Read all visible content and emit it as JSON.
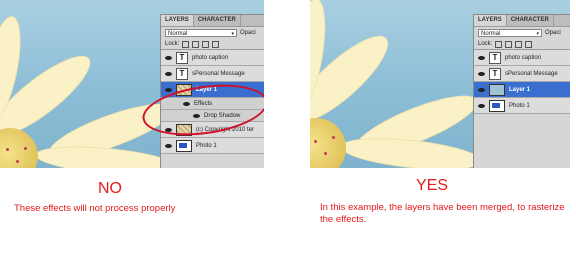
{
  "left": {
    "tabs": [
      "LAYERS",
      "CHARACTER"
    ],
    "blend_mode": "Normal",
    "opacity_label": "Opaci",
    "lock_label": "Lock:",
    "layers": [
      {
        "type": "text",
        "name": "photo caption"
      },
      {
        "type": "text",
        "name": "sPersonal Message"
      },
      {
        "type": "image",
        "name": "Layer 1",
        "selected": true
      },
      {
        "type": "effects",
        "name": "Effects"
      },
      {
        "type": "effect",
        "name": "Drop Shadow"
      },
      {
        "type": "image",
        "name": "(c) Copyright 2010 ter"
      },
      {
        "type": "photo",
        "name": "Photo 1"
      }
    ],
    "verdict": "NO",
    "description": "These effects will not process properly"
  },
  "right": {
    "tabs": [
      "LAYERS",
      "CHARACTER"
    ],
    "blend_mode": "Normal",
    "opacity_label": "Opaci",
    "lock_label": "Lock:",
    "layers": [
      {
        "type": "text",
        "name": "photo caption"
      },
      {
        "type": "text",
        "name": "sPersonal Message"
      },
      {
        "type": "image",
        "name": "Layer 1",
        "selected": true
      },
      {
        "type": "photo",
        "name": "Photo 1"
      }
    ],
    "verdict": "YES",
    "description": "In this example, the layers have been merged, to rasterize the effects."
  },
  "colors": {
    "caption": "#e41a1c",
    "selected_layer": "#3a6fcf",
    "highlight_oval": "#d0102a"
  },
  "icons": {
    "text_layer": "T",
    "visibility": "eye-icon",
    "dropdown": "▾"
  }
}
